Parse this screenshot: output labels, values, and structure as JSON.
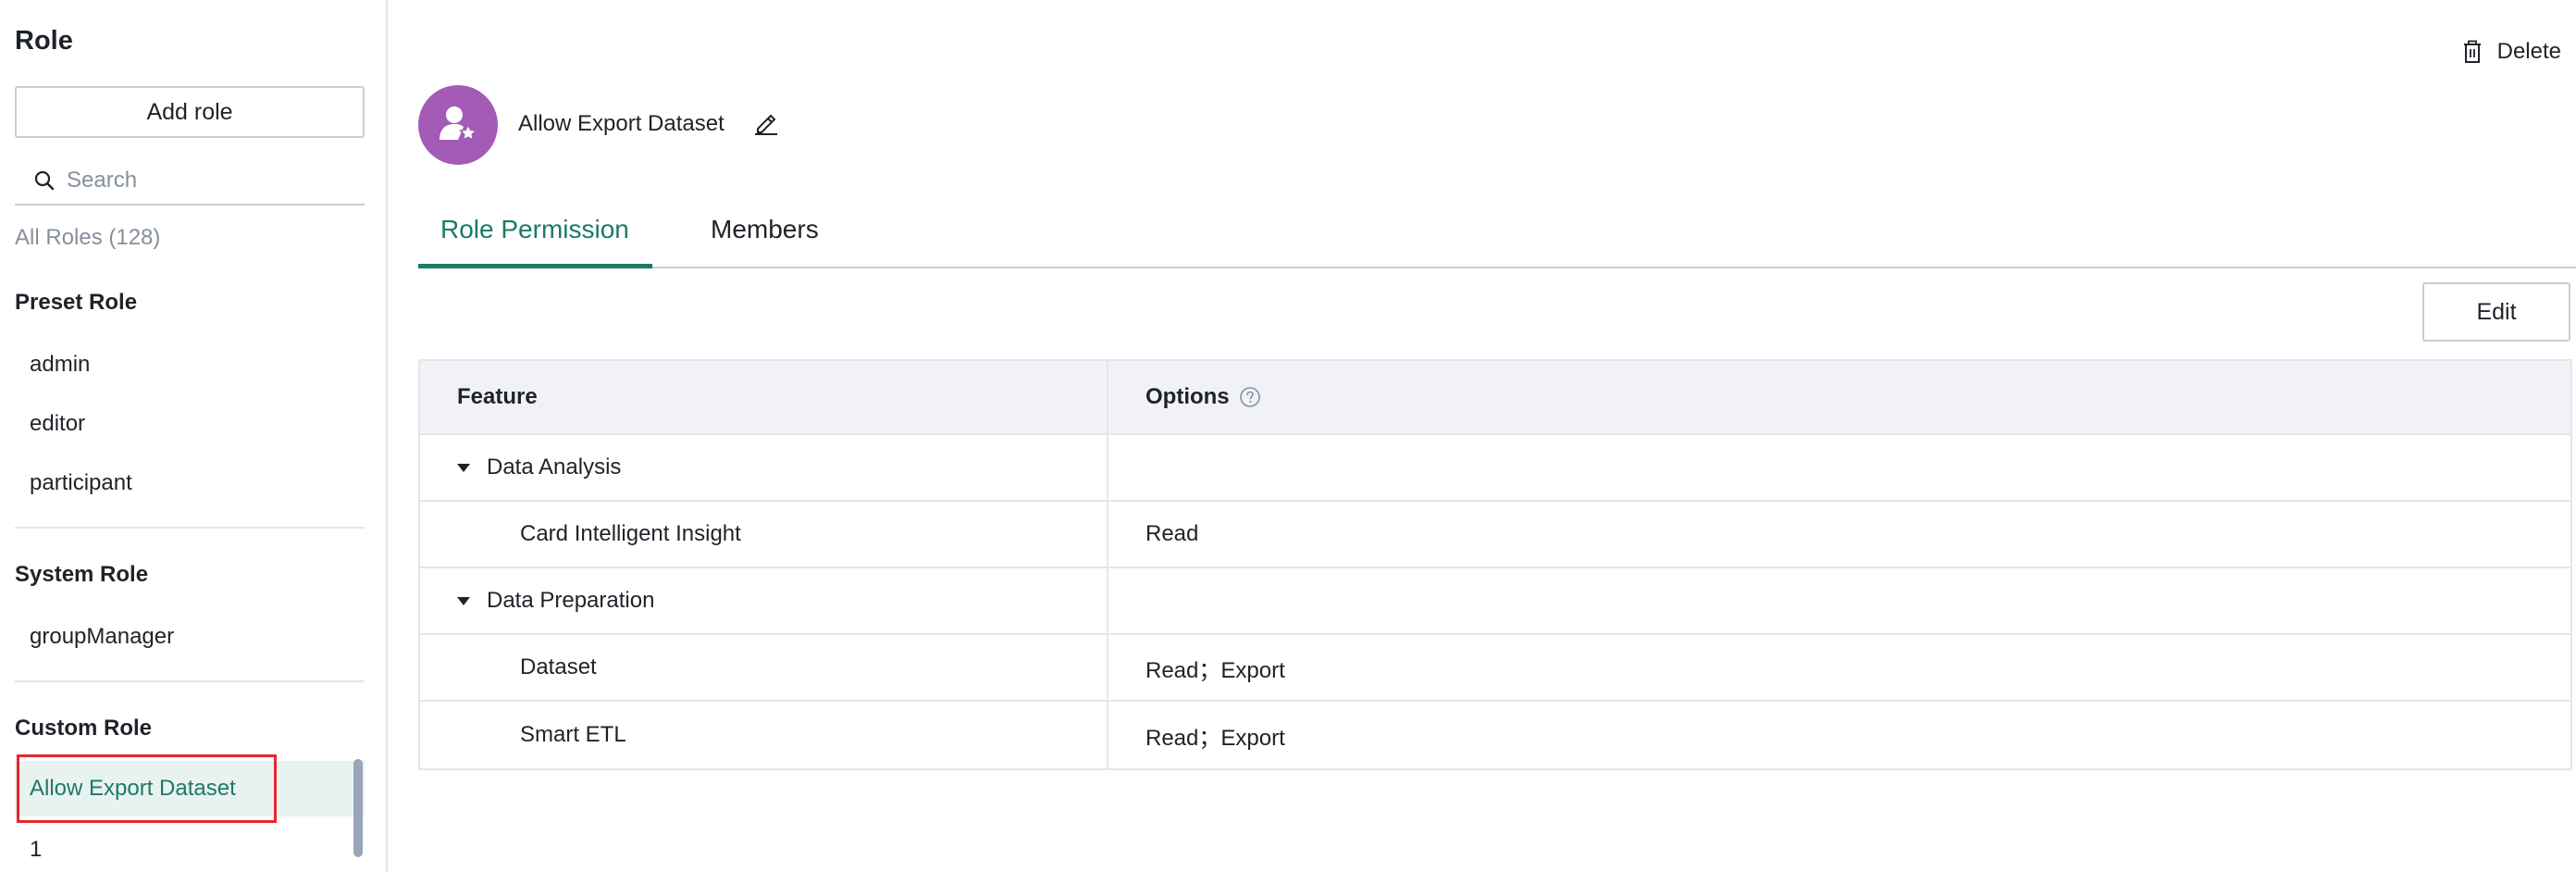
{
  "sidebar": {
    "title": "Role",
    "add_role_label": "Add role",
    "search_placeholder": "Search",
    "all_roles_label": "All Roles (128)",
    "preset": {
      "heading": "Preset Role",
      "items": [
        "admin",
        "editor",
        "participant"
      ]
    },
    "system": {
      "heading": "System Role",
      "items": [
        "groupManager"
      ]
    },
    "custom": {
      "heading": "Custom Role",
      "items": [
        "Allow Export Dataset",
        "1"
      ],
      "selected": "Allow Export Dataset"
    }
  },
  "header": {
    "role_name": "Allow Export Dataset",
    "delete_label": "Delete",
    "avatar_color": "#a45bb5"
  },
  "tabs": {
    "items": [
      "Role Permission",
      "Members"
    ],
    "active": "Role Permission"
  },
  "toolbar": {
    "edit_label": "Edit"
  },
  "table": {
    "columns": [
      "Feature",
      "Options"
    ],
    "rows": [
      {
        "feature": "Data Analysis",
        "options": "",
        "group": true
      },
      {
        "feature": "Card Intelligent Insight",
        "options": "Read",
        "group": false
      },
      {
        "feature": "Data Preparation",
        "options": "",
        "group": true
      },
      {
        "feature": "Dataset",
        "options": "Read；Export",
        "group": false
      },
      {
        "feature": "Smart ETL",
        "options": "Read；Export",
        "group": false
      }
    ]
  },
  "colors": {
    "accent": "#1c7a68",
    "selected_bg": "#e8f2ef",
    "highlight_border": "#e8262b"
  },
  "icons": [
    "search-icon",
    "trash-icon",
    "user-star-icon",
    "pencil-icon",
    "caret-down-icon",
    "help-circle-icon"
  ]
}
